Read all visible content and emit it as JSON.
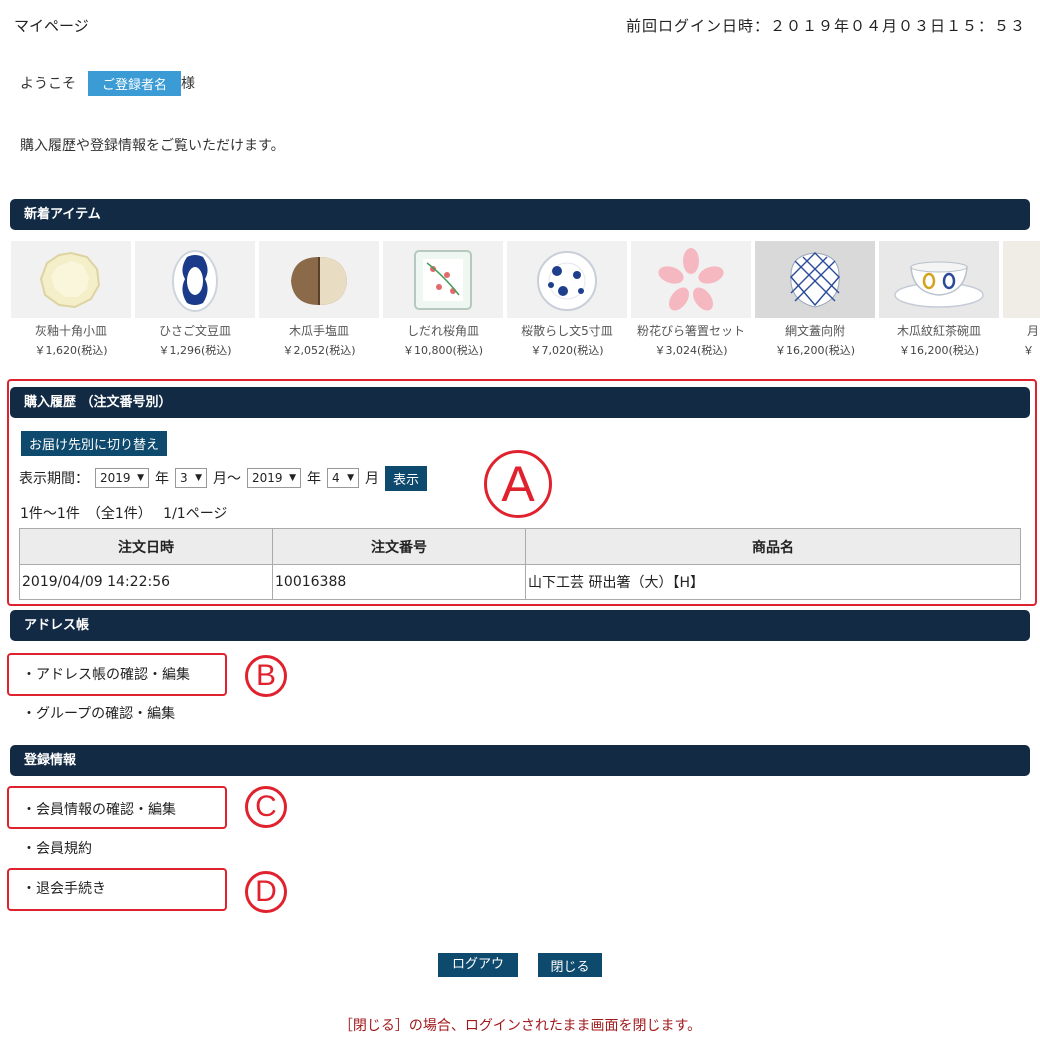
{
  "header": {
    "title": "マイページ",
    "last_login": "前回ログイン日時：２０１９年０４月０３日１５：５３"
  },
  "welcome": {
    "prefix": "ようこそ",
    "name": "ご登録者名",
    "suffix": "様"
  },
  "intro": "購入履歴や登録情報をご覧いただけます。",
  "new_items": {
    "title": "新着アイテム",
    "items": [
      {
        "name": "灰釉十角小皿",
        "price": "￥1,620(税込)"
      },
      {
        "name": "ひさご文豆皿",
        "price": "￥1,296(税込)"
      },
      {
        "name": "木瓜手塩皿",
        "price": "￥2,052(税込)"
      },
      {
        "name": "しだれ桜角皿",
        "price": "￥10,800(税込)"
      },
      {
        "name": "桜散らし文5寸皿",
        "price": "￥7,020(税込)"
      },
      {
        "name": "粉花びら箸置セット",
        "price": "￥3,024(税込)"
      },
      {
        "name": "網文蓋向附",
        "price": "￥16,200(税込)"
      },
      {
        "name": "木瓜紋紅茶碗皿",
        "price": "￥16,200(税込)"
      },
      {
        "name": "月",
        "price": "￥"
      }
    ]
  },
  "history": {
    "title": "購入履歴 （注文番号別）",
    "switch_button": "お届け先別に切り替え",
    "period_label": "表示期間：",
    "from_year": "2019",
    "from_month": "3",
    "to_year": "2019",
    "to_month": "4",
    "year_unit": "年",
    "month_unit_from": "月～",
    "month_unit_to": "月",
    "show_button": "表示",
    "count_text": "1件～1件　（全1件）　 1/1ページ",
    "columns": [
      "注文日時",
      "注文番号",
      "商品名"
    ],
    "rows": [
      {
        "date": "2019/04/09 14:22:56",
        "order_no": "10016388",
        "product": "山下工芸 研出箸（大）【H】"
      }
    ]
  },
  "address_book": {
    "title": "アドレス帳",
    "links": [
      "・アドレス帳の確認・編集",
      "・グループの確認・編集"
    ]
  },
  "registration": {
    "title": "登録情報",
    "links": [
      "・会員情報の確認・編集",
      "・会員規約",
      "・退会手続き"
    ]
  },
  "annotations": {
    "a": "A",
    "b": "B",
    "c": "C",
    "d": "D"
  },
  "buttons": {
    "logout": "ログアウト",
    "close": "閉じる"
  },
  "footnote": "［閉じる］の場合、ログインされたまま画面を閉じます。",
  "colors": {
    "bar": "#122a44",
    "button": "#0e4a6e",
    "badge": "#3a9bd5",
    "annotation": "#e0222e",
    "footnote": "#a0191d"
  }
}
